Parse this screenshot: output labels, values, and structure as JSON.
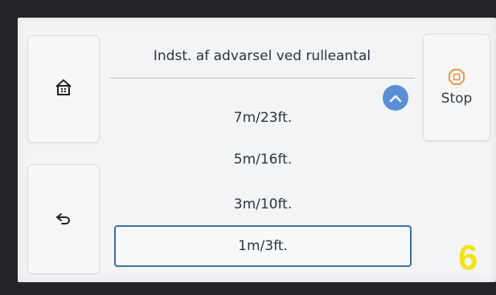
{
  "screen": {
    "title": "Indst. af advarsel ved rulleantal",
    "stop_label": "Stop",
    "step_number": "6"
  },
  "options": [
    {
      "label": "7m/23ft.",
      "selected": false
    },
    {
      "label": "5m/16ft.",
      "selected": false
    },
    {
      "label": "3m/10ft.",
      "selected": false
    },
    {
      "label": "1m/3ft.",
      "selected": true
    }
  ],
  "icons": {
    "home": "home-icon",
    "back": "back-arrow-icon",
    "stop": "stop-icon",
    "scroll_up": "chevron-up-icon"
  },
  "colors": {
    "accent": "#5a8fd6",
    "selected_border": "#3f6f9f",
    "stop_icon": "#e39a4b",
    "step_number": "#f2e21b"
  }
}
